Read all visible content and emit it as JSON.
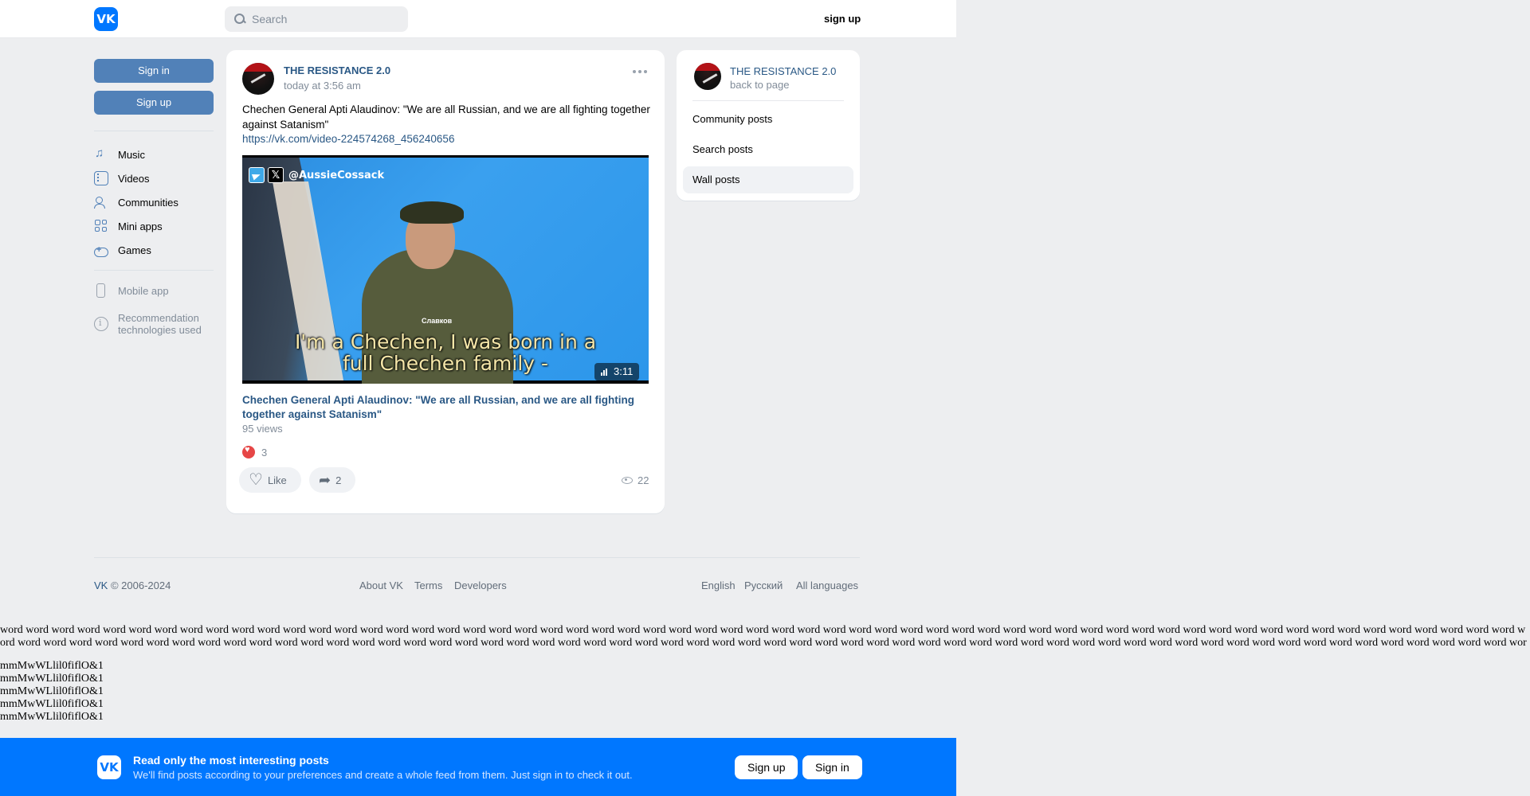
{
  "header": {
    "logo_text": "VK",
    "search_placeholder": "Search",
    "signup_label": "sign up"
  },
  "sidebar": {
    "sign_in_label": "Sign in",
    "sign_up_label": "Sign up",
    "nav_items": [
      {
        "label": "Music",
        "icon": "music-icon"
      },
      {
        "label": "Videos",
        "icon": "video-icon"
      },
      {
        "label": "Communities",
        "icon": "users-icon"
      },
      {
        "label": "Mini apps",
        "icon": "apps-icon"
      },
      {
        "label": "Games",
        "icon": "gamepad-icon"
      }
    ],
    "mobile_app_label": "Mobile app",
    "reco_label_line1": "Recommendation",
    "reco_label_line2": "technologies used"
  },
  "post": {
    "author": "THE RESISTANCE 2.0",
    "time": "today at 3:56 am",
    "text": "Chechen General Apti Alaudinov: \"We are all Russian, and we are all fighting together against Satanism\"",
    "link": "https://vk.com/video-224574268_456240656",
    "video": {
      "watermark_handle": "@AussieCossack",
      "subtitle_line1": "I'm a Chechen, I was born in a",
      "subtitle_line2": "full Chechen family -",
      "duration": "3:11",
      "brand_mark": "Славков"
    },
    "video_title": "Chechen General Apti Alaudinov: \"We are all Russian, and we are all fighting together against Satanism\"",
    "video_views": "95 views",
    "reactions_count": "3",
    "like_label": "Like",
    "share_count": "2",
    "views_count": "22"
  },
  "right_panel": {
    "name": "THE RESISTANCE 2.0",
    "back_label": "back to page",
    "items": [
      {
        "label": "Community posts",
        "active": false
      },
      {
        "label": "Search posts",
        "active": false
      },
      {
        "label": "Wall posts",
        "active": true
      }
    ]
  },
  "footer": {
    "copy_brand": "VK",
    "copy_rest": " © 2006-2024",
    "links": [
      "About VK",
      "Terms",
      "Developers"
    ],
    "languages": [
      "English",
      "Русский",
      "All languages"
    ]
  },
  "junk": {
    "words": "word word word word word word word word word word word word word word word word word word word word word word word word word word word word word word word word word word word word word word word word word word word word word word word word word word word word word word word word word word word word word word word word word word word word word word word word word word word word word word word word word word word word word word word word word word word word word word word word word word word word word word word word word word word word word word word word word word word word word word word word word word word word word word word word word word word word word word word word word word word word word word word word",
    "lines": [
      "mmMwWLlil0fiflO&1",
      "mmMwWLlil0fiflO&1",
      "mmMwWLlil0fiflO&1",
      "mmMwWLlil0fiflO&1",
      "mmMwWLlil0fiflO&1"
    ]
  },
  "banner": {
    "logo_text": "VK",
    "title": "Read only the most interesting posts",
    "subtitle": "We'll find posts according to your preferences and create a whole feed from them. Just sign in to check it out.",
    "signup_label": "Sign up",
    "signin_label": "Sign in"
  },
  "colors": {
    "brand_blue": "#0077ff",
    "button_blue": "#5181b8",
    "link_blue": "#2a5885",
    "page_bg": "#edeef0",
    "heart_red": "#e64646"
  }
}
